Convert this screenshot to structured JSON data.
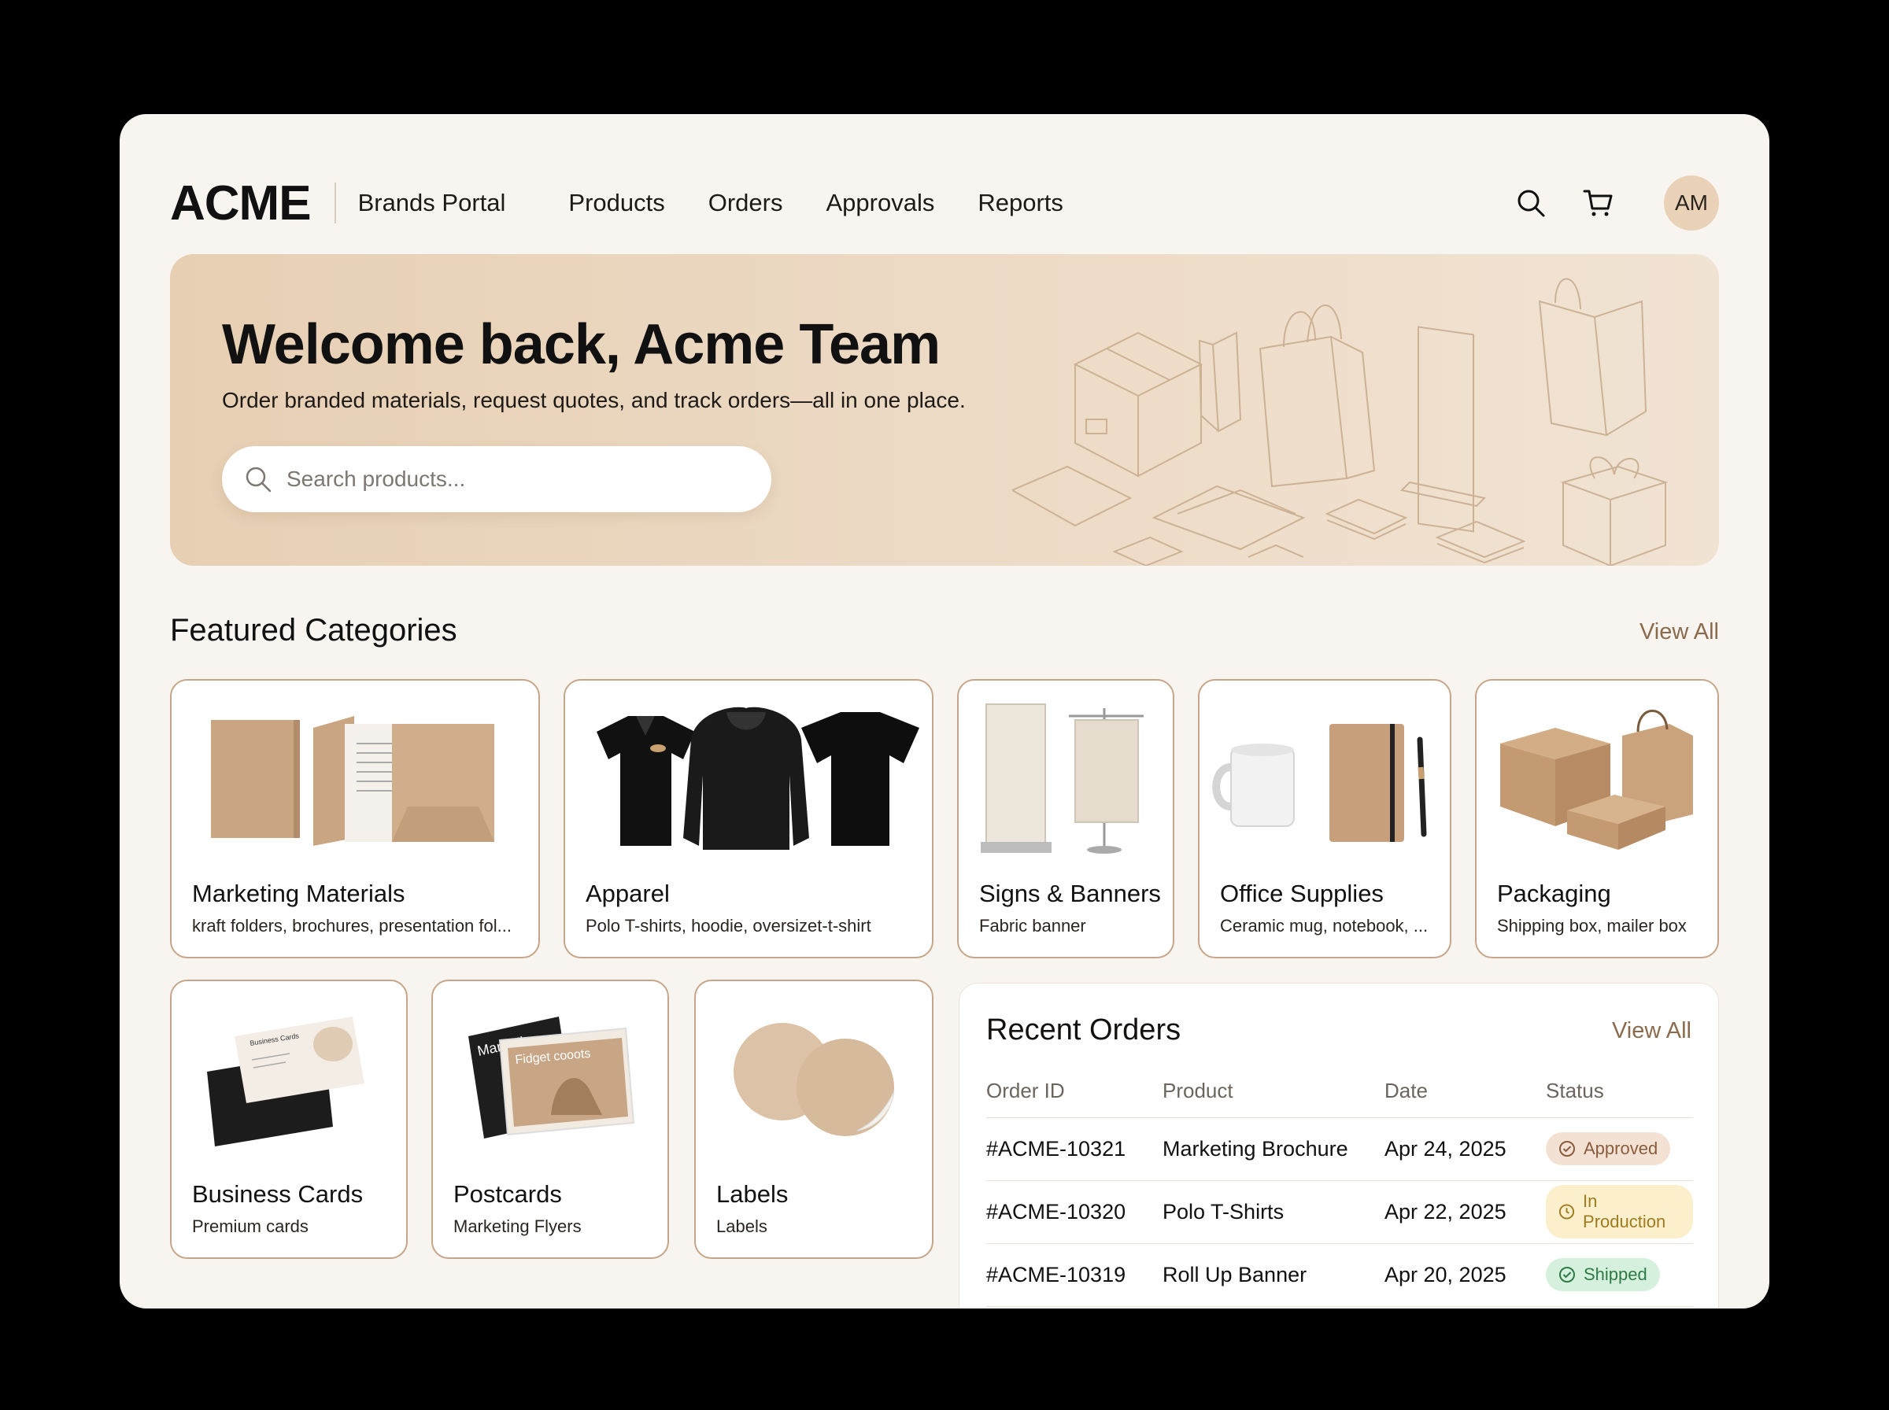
{
  "header": {
    "logo": "ACME",
    "portal": "Brands Portal",
    "nav": [
      "Products",
      "Orders",
      "Approvals",
      "Reports"
    ],
    "icons": [
      "search-icon",
      "cart-icon"
    ],
    "avatar_initials": "AM"
  },
  "hero": {
    "title": "Welcome back, Acme Team",
    "subtitle": "Order branded materials, request quotes, and track orders—all in one place.",
    "search_placeholder": "Search products..."
  },
  "featured": {
    "title": "Featured Categories",
    "view_all": "View All",
    "categories": [
      {
        "title": "Marketing Materials",
        "desc": "kraft folders, brochures, presentation fol..."
      },
      {
        "title": "Apparel",
        "desc": "Polo T-shirts, hoodie, oversizet-t-shirt"
      },
      {
        "title": "Signs & Banners",
        "desc": "Fabric banner"
      },
      {
        "title": "Office Supplies",
        "desc": "Ceramic mug, notebook, ..."
      },
      {
        "title": "Packaging",
        "desc": "Shipping box, mailer box"
      },
      {
        "title": "Business Cards",
        "desc": "Premium cards"
      },
      {
        "title": "Postcards",
        "desc": "Marketing Flyers"
      },
      {
        "title": "Labels",
        "desc": "Labels"
      }
    ],
    "image_text": {
      "business_card": "Business Cards",
      "postcard_back": "Mark Flye",
      "postcard_front": "Fidget cooots"
    }
  },
  "orders": {
    "title": "Recent Orders",
    "view_all": "View All",
    "columns": [
      "Order ID",
      "Product",
      "Date",
      "Status"
    ],
    "rows": [
      {
        "id": "#ACME-10321",
        "product": "Marketing Brochure",
        "date": "Apr 24, 2025",
        "status": "Approved"
      },
      {
        "id": "#ACME-10320",
        "product": "Polo T-Shirts",
        "date": "Apr 22, 2025",
        "status": "In Production"
      },
      {
        "id": "#ACME-10319",
        "product": "Roll Up Banner",
        "date": "Apr 20, 2025",
        "status": "Shipped"
      }
    ]
  },
  "colors": {
    "accent": "#8a6b4e",
    "hero_bg": "#e7cfb3",
    "card_border": "#c6a68a",
    "approved": "#8a5c3d",
    "in_production": "#a07b1e",
    "shipped": "#2f7a46"
  }
}
